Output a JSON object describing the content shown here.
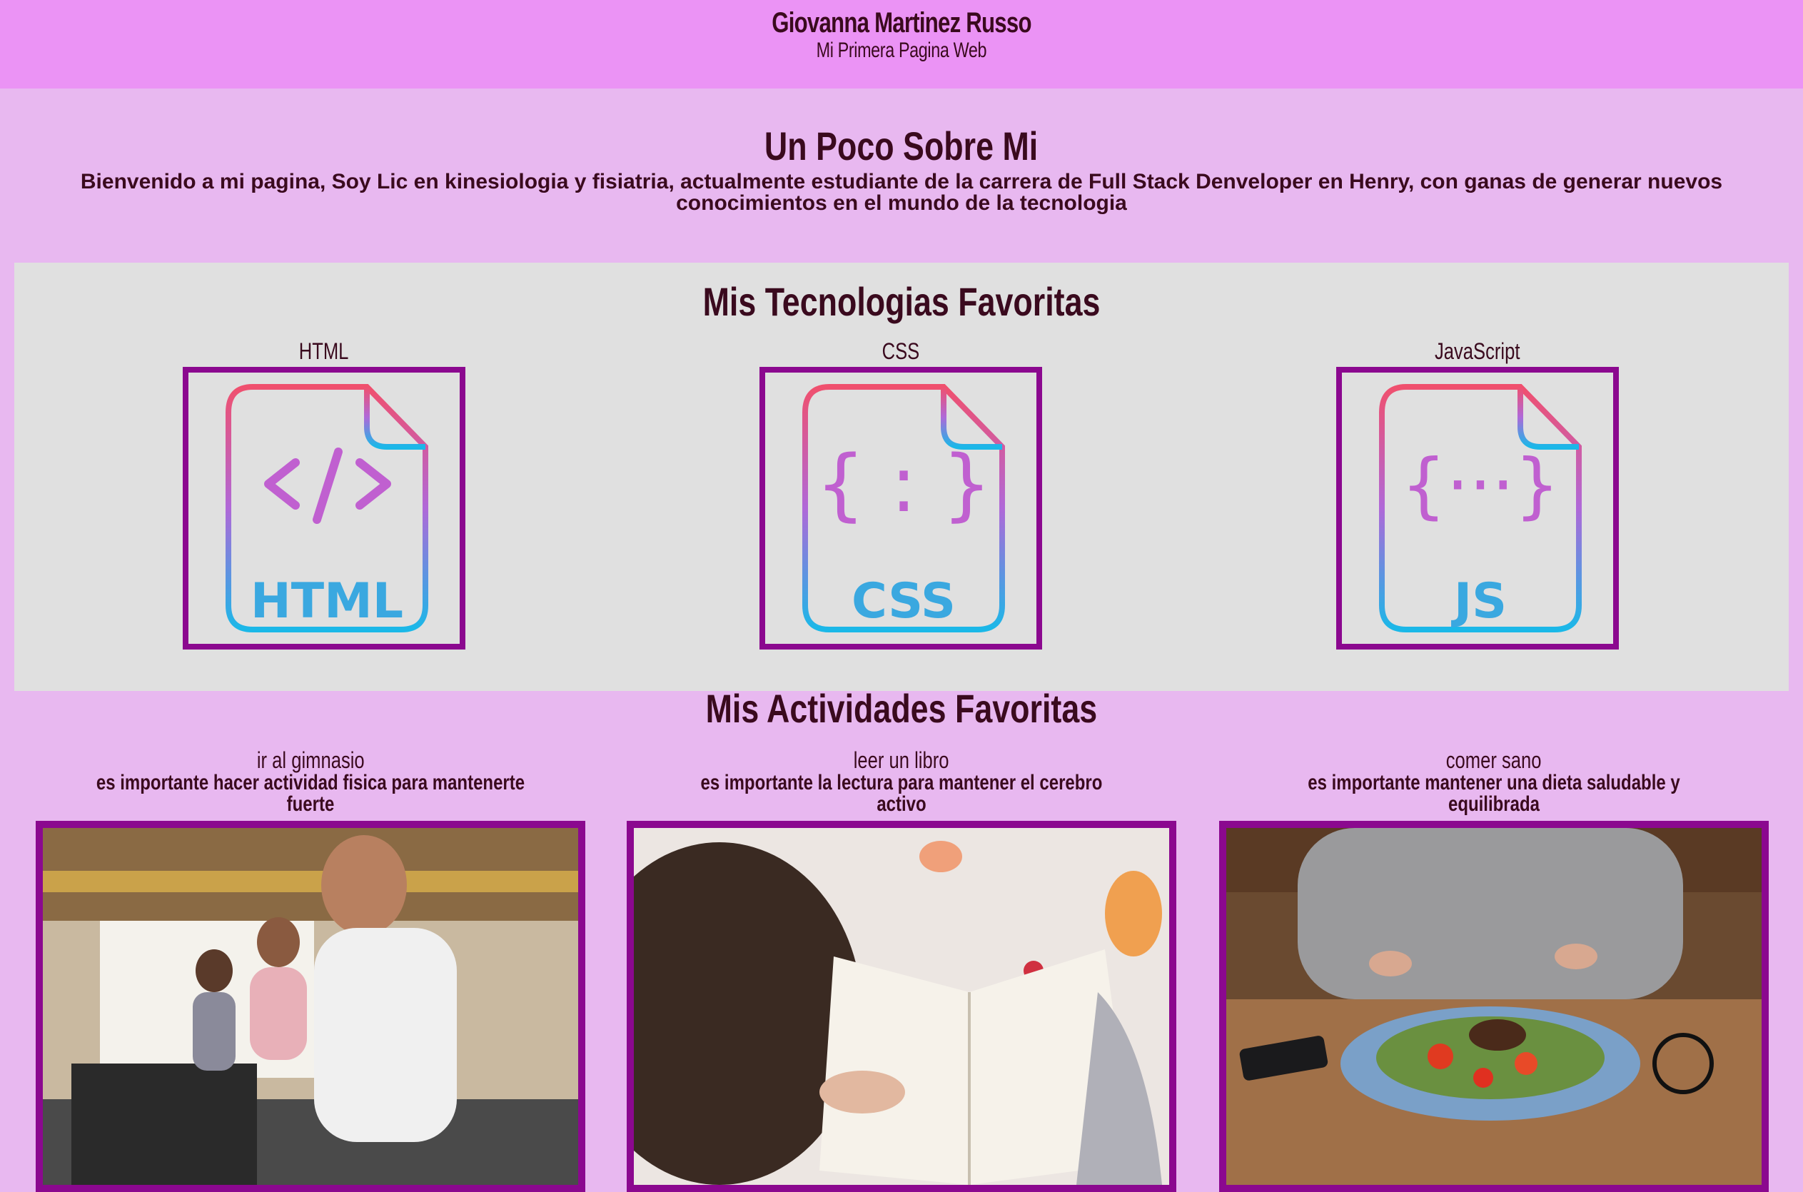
{
  "header": {
    "name": "Giovanna Martinez Russo",
    "subtitle": "Mi Primera Pagina Web"
  },
  "about": {
    "title": "Un Poco Sobre Mi",
    "text": "Bienvenido a mi pagina, Soy Lic en kinesiologia y fisiatria, actualmente estudiante de la carrera de Full Stack Denveloper en Henry, con ganas de generar nuevos conocimientos en el mundo de la tecnologia"
  },
  "technologies": {
    "title": "Mis Tecnologias Favoritas",
    "items": [
      {
        "label": "HTML",
        "badge": "HTML",
        "icon": "html-file-icon"
      },
      {
        "label": "CSS",
        "badge": "CSS",
        "icon": "css-file-icon"
      },
      {
        "label": "JavaScript",
        "badge": "JS",
        "icon": "js-file-icon"
      }
    ]
  },
  "activities": {
    "title": "Mis Actividades Favoritas",
    "items": [
      {
        "title": "ir al gimnasio",
        "description": "es importante hacer actividad fisica para mantenerte fuerte",
        "image": "gym-photo"
      },
      {
        "title": "leer un libro",
        "description": "es importante la lectura para mantener el cerebro activo",
        "image": "reading-photo"
      },
      {
        "title": "comer sano",
        "description": "es importante mantener una dieta saludable y equilibrada",
        "image": "healthy-food-photo"
      }
    ]
  },
  "colors": {
    "header_bg": "#eb93f5",
    "page_bg": "#e8b8f0",
    "panel_bg": "#e0e0e0",
    "border": "#8b088f",
    "text": "#3a0a1e"
  }
}
